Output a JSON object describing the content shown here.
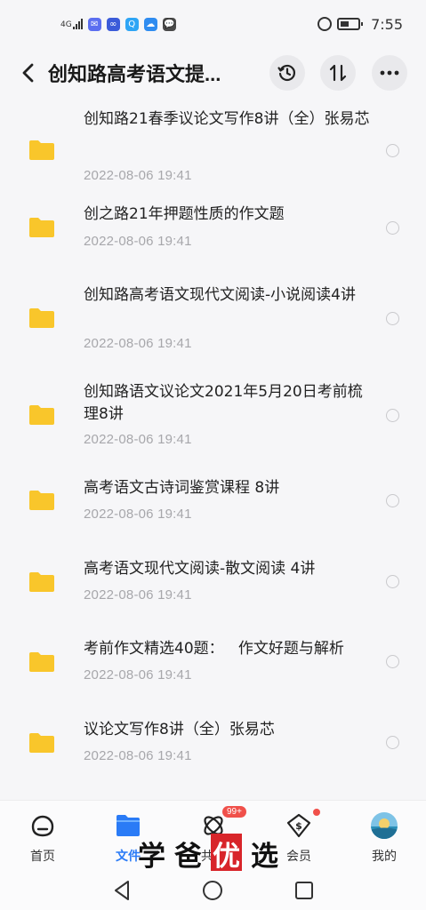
{
  "status_bar": {
    "network": "4G",
    "time": "7:55",
    "apps": [
      {
        "icon": "messages-app-icon",
        "glyph": "✉",
        "color": "#5b6ef0"
      },
      {
        "icon": "link-app-icon",
        "glyph": "∞",
        "color": "#3b5bd9"
      },
      {
        "icon": "search-app-icon",
        "glyph": "Q",
        "color": "#2ea5f5"
      },
      {
        "icon": "cloud-app-icon",
        "glyph": "☁",
        "color": "#2f8cf0"
      },
      {
        "icon": "chat-app-icon",
        "glyph": "💬",
        "color": "#4a4a4a"
      }
    ]
  },
  "header": {
    "title": "创知路高考语文提...",
    "buttons": [
      "history",
      "sort",
      "more"
    ]
  },
  "files": [
    {
      "name": "创知路21春季议论文写作8讲（全）张易芯",
      "date": "2022-08-06  19:41"
    },
    {
      "name": "创之路21年押题性质的作文题",
      "date": "2022-08-06  19:41"
    },
    {
      "name": "创知路高考语文现代文阅读-小说阅读4讲",
      "date": "2022-08-06  19:41"
    },
    {
      "name": "创知路语文议论文2021年5月20日考前梳理8讲",
      "date": "2022-08-06  19:41"
    },
    {
      "name": "高考语文古诗词鉴赏课程 8讲",
      "date": "2022-08-06  19:41"
    },
    {
      "name": "高考语文现代文阅读-散文阅读 4讲",
      "date": "2022-08-06  19:41"
    },
    {
      "name": "考前作文精选40题：   作文好题与解析",
      "date": "2022-08-06  19:41"
    },
    {
      "name": "议论文写作8讲（全）张易芯",
      "date": "2022-08-06  19:41"
    }
  ],
  "bottom_nav": {
    "items": [
      {
        "label": "首页",
        "icon": "home-icon",
        "active": false
      },
      {
        "label": "文件",
        "icon": "file-folder-icon",
        "active": true
      },
      {
        "label": "共享",
        "icon": "share-icon",
        "active": false,
        "badge": "99+"
      },
      {
        "label": "会员",
        "icon": "vip-icon",
        "active": false,
        "dot": true
      },
      {
        "label": "我的",
        "icon": "avatar",
        "active": false
      }
    ]
  },
  "watermark": {
    "chars": [
      "学",
      "爸",
      "优",
      "选"
    ],
    "highlight_index": 2
  },
  "colors": {
    "accent": "#2a7bf6",
    "folder": "#f9c62b",
    "badge": "#f0504a",
    "date": "#a7a7ab"
  }
}
